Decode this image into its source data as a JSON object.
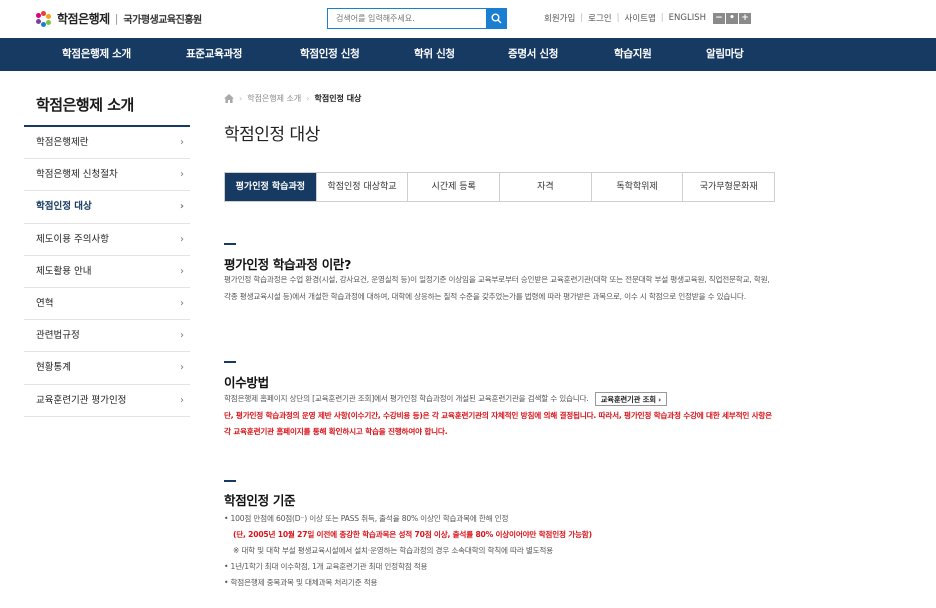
{
  "header": {
    "logo_main": "학점은행제",
    "logo_sep": "|",
    "logo_sub": "국가평생교육진흥원",
    "search_placeholder": "검색어를 입력해주세요.",
    "util_links": [
      "회원가입",
      "로그인",
      "사이트맵",
      "ENGLISH"
    ],
    "zoom": [
      "−",
      "•",
      "+"
    ]
  },
  "nav": [
    "학점은행제 소개",
    "표준교육과정",
    "학점인정 신청",
    "학위 신청",
    "증명서 신청",
    "학습지원",
    "알림마당"
  ],
  "sidebar": {
    "title": "학점은행제 소개",
    "items": [
      "학점은행제란",
      "학점은행제 신청절차",
      "학점인정 대상",
      "제도이용 주의사항",
      "제도활용 안내",
      "연혁",
      "관련법규정",
      "현황통계",
      "교육훈련기관 평가인정"
    ],
    "active_index": 2,
    "chevron": "›"
  },
  "breadcrumb": [
    "학점은행제 소개",
    "학점인정 대상"
  ],
  "page_title": "학점인정 대상",
  "tabs": [
    "평가인정 학습과정",
    "학점인정 대상학교",
    "시간제 등록",
    "자격",
    "독학학위제",
    "국가무형문화재"
  ],
  "sections": {
    "s1": {
      "heading": "평가인정 학습과정 이란?",
      "body": "평가인정 학습과정은 수업 환경(시설, 강사요건, 운영실적 등)이 일정기준 이상임을 교육부로부터 승인받은 교육훈련기관(대학 또는 전문대학 부설 평생교육원, 직업전문학교, 학원, 각종 평생교육시설 등)에서 개설한 학습과정에 대하여, 대학에 상응하는 질적 수준을 갖추었는가를 법령에 따라 평가받은 과목으로, 이수 시 학점으로 인정받을 수 있습니다."
    },
    "s2": {
      "heading": "이수방법",
      "body": "학점은행제 홈페이지 상단의 [교육훈련기관 조회]에서 평가인정 학습과정이 개설된 교육훈련기관을 검색할 수 있습니다.",
      "button": "교육훈련기관 조회 ›",
      "notice": "단, 평가인정 학습과정의 운영 제반 사항(이수기간, 수강비용 등)은 각 교육훈련기관의 자체적인 방침에 의해 결정됩니다. 따라서, 평가인정 학습과정 수강에 대한 세부적인 사항은 각 교육훈련기관 홈페이지를 통해 확인하시고 학습을 진행하여야 합니다."
    },
    "s3": {
      "heading": "학점인정 기준",
      "line1": "• 100점 만점에 60점(D⁻) 이상 또는 PASS 취득, 출석율 80% 이상인 학습과목에 한해 인정",
      "line2": "(단, 2005년 10월 27일 이전에 종강한 학습과목은 성적 70점 이상, 출석률 80% 이상이어야만 학점인정 가능함)",
      "line3": "※ 대학 및 대학 부설 평생교육시설에서 설치·운영하는 학습과정의 경우 소속대학의 학칙에 따라 별도적용",
      "line4": "• 1년/1학기 최대 이수학점, 1개 교육훈련기관 최대 인정학점 적용",
      "line5": "• 학점은행제 중복과목 및 대체과목 처리기준 적용"
    }
  },
  "colors": {
    "navy": "#173a63",
    "accent_blue": "#1a7fd1",
    "red": "#d9141b"
  }
}
